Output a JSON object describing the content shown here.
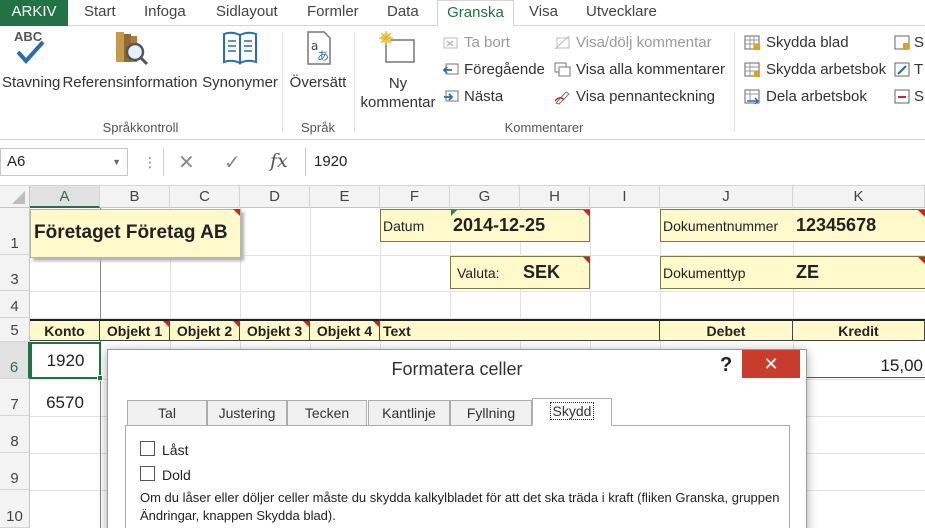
{
  "tabs": {
    "file": "ARKIV",
    "items": [
      "Start",
      "Infoga",
      "Sidlayout",
      "Formler",
      "Data",
      "Granska",
      "Visa",
      "Utvecklare"
    ],
    "active": "Granska"
  },
  "ribbon": {
    "proofing": {
      "spelling": "Stavning",
      "research": "Referensinformation",
      "thesaurus": "Synonymer",
      "spelling_icon_text": "ABC",
      "group": "Språkkontroll"
    },
    "language": {
      "translate": "Översätt",
      "group": "Språk"
    },
    "comments": {
      "new_line1": "Ny",
      "new_line2": "kommentar",
      "delete": "Ta bort",
      "previous": "Föregående",
      "next": "Nästa",
      "show_hide": "Visa/dölj kommentar",
      "show_all": "Visa alla kommentarer",
      "show_ink": "Visa pennanteckning",
      "group": "Kommentarer"
    },
    "changes": {
      "protect_sheet": "Skydda blad",
      "protect_workbook": "Skydda arbetsbok",
      "share_workbook": "Dela arbetsbok",
      "partial_1": "S",
      "partial_2": "T",
      "partial_3": "S"
    }
  },
  "formula_bar": {
    "name_box": "A6",
    "dots": "⋮",
    "cancel_icon": "✕",
    "enter_icon": "✓",
    "fx_icon": "fx",
    "value": "1920"
  },
  "grid": {
    "columns": [
      "A",
      "B",
      "C",
      "D",
      "E",
      "F",
      "G",
      "H",
      "I",
      "J",
      "K"
    ],
    "rows": [
      "1",
      "3",
      "4",
      "5",
      "6",
      "7",
      "8",
      "9",
      "10"
    ],
    "selected_cell": "A6"
  },
  "sheet": {
    "company": "Företaget Företag AB",
    "date_label": "Datum",
    "date_value": "2014-12-25",
    "doc_number_label": "Dokumentnummer",
    "doc_number_value": "12345678",
    "currency_label": "Valuta:",
    "currency_value": "SEK",
    "doc_type_label": "Dokumenttyp",
    "doc_type_value": "ZE",
    "headers": [
      "Konto",
      "Objekt 1",
      "Objekt 2",
      "Objekt 3",
      "Objekt 4",
      "Text",
      "Debet",
      "Kredit"
    ],
    "row6": {
      "konto": "1920",
      "kredit": "15,00"
    },
    "row7": {
      "konto": "6570"
    }
  },
  "dialog": {
    "title": "Formatera celler",
    "help": "?",
    "close": "✕",
    "tabs": [
      "Tal",
      "Justering",
      "Tecken",
      "Kantlinje",
      "Fyllning",
      "Skydd"
    ],
    "active_tab": "Skydd",
    "locked": "Låst",
    "hidden": "Dold",
    "locked_checked": false,
    "hidden_checked": false,
    "note": "Om du låser eller döljer celler måste du skydda kalkylbladet för att det ska träda i kraft (fliken Granska, gruppen Ändringar, knappen Skydda blad)."
  },
  "colors": {
    "excel_green": "#217346",
    "cell_fill": "#fff9cc",
    "comment_marker": "#d4201b",
    "close_button": "#c83c2c"
  }
}
